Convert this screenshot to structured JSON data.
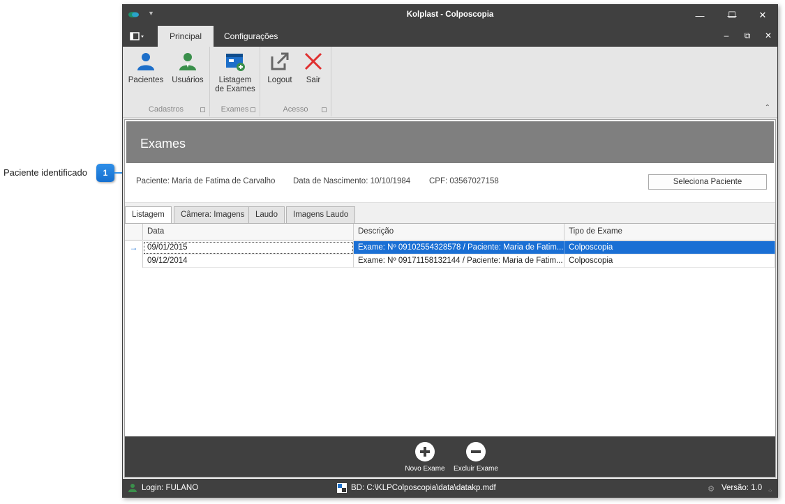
{
  "annotation": {
    "badge": "1",
    "label": "Paciente identificado"
  },
  "window": {
    "title": "Kolplast - Colposcopia",
    "minimize": "—",
    "maximize": "☐",
    "close": "✕"
  },
  "ribbon_tabs": [
    "Principal",
    "Configurações"
  ],
  "ribbon_groups": [
    {
      "caption": "Cadastros",
      "buttons": [
        {
          "label": "Pacientes",
          "icon": "person-icon"
        },
        {
          "label": "Usuários",
          "icon": "user-icon"
        }
      ]
    },
    {
      "caption": "Exames",
      "buttons": [
        {
          "label_line1": "Listagem",
          "label_line2": "de Exames",
          "icon": "exam-list-icon"
        }
      ]
    },
    {
      "caption": "Acesso",
      "buttons": [
        {
          "label": "Logout",
          "icon": "logout-icon"
        },
        {
          "label": "Sair",
          "icon": "close-x-icon"
        }
      ]
    }
  ],
  "panel": {
    "title": "Exames",
    "patient": "Paciente: Maria de Fatima de Carvalho",
    "birth": "Data de Nascimento: 10/10/1984",
    "cpf": "CPF: 03567027158",
    "select_button": "Seleciona Paciente"
  },
  "tabs": [
    "Listagem",
    "Câmera: Imagens",
    "Laudo",
    "Imagens Laudo"
  ],
  "grid": {
    "columns": [
      "Data",
      "Descrição",
      "Tipo de Exame"
    ],
    "rows": [
      {
        "data": "09/01/2015",
        "descricao": "Exame: Nº 09102554328578  /  Paciente: Maria de Fatim...",
        "tipo": "Colposcopia",
        "selected": true
      },
      {
        "data": "09/12/2014",
        "descricao": "Exame: Nº 09171158132144  /  Paciente: Maria de Fatim...",
        "tipo": "Colposcopia",
        "selected": false
      }
    ]
  },
  "actions": {
    "new": "Novo Exame",
    "delete": "Excluir Exame"
  },
  "status": {
    "login": "Login: FULANO",
    "db": "BD: C:\\KLPColposcopia\\data\\datakp.mdf",
    "version": "Versão: 1.0"
  },
  "colors": {
    "accent": "#1a6fd4",
    "dark": "#404040",
    "header_gray": "#7f7f7f"
  }
}
